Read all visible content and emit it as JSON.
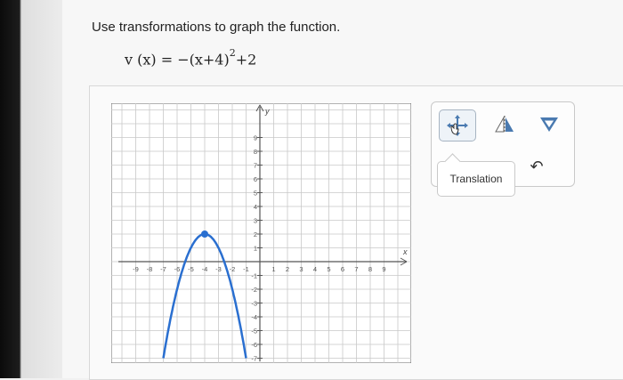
{
  "prompt": "Use transformations to graph the function.",
  "formula": {
    "lhs": "v (x) = ",
    "rhs_before_exp": "−(x+4)",
    "exponent": "2",
    "rhs_after_exp": "+2"
  },
  "graph": {
    "x_ticks": [
      "-9",
      "-8",
      "-7",
      "-6",
      "-5",
      "-4",
      "-3",
      "-2",
      "-1",
      "1",
      "2",
      "3",
      "4",
      "5",
      "6",
      "7",
      "8",
      "9"
    ],
    "y_ticks": [
      "-7",
      "-6",
      "-5",
      "-4",
      "-3",
      "-2",
      "-1",
      "1",
      "2",
      "3",
      "4",
      "5",
      "6",
      "7",
      "8",
      "9"
    ],
    "x_axis_label": "x",
    "y_axis_label": "y",
    "plotted_curve": {
      "vertex": [
        -4,
        2
      ],
      "equation": "y = -(x+4)^2 + 2",
      "color": "#2a6fd0"
    }
  },
  "tools": {
    "translate_icon": "move-arrows-icon",
    "reflect_icon": "reflect-triangle-icon",
    "dilate_icon": "dilate-icon",
    "tooltip": "Translation",
    "undo_icon": "undo-icon",
    "undo_symbol": "↶"
  }
}
